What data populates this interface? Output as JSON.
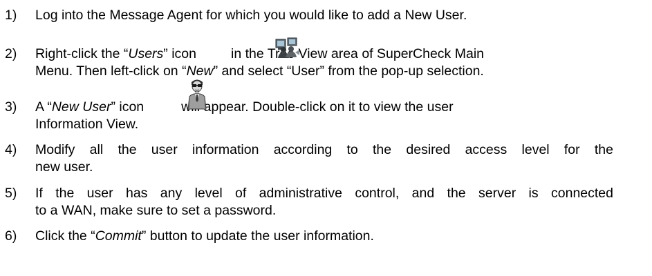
{
  "steps": [
    {
      "num": "1)",
      "text": "Log into the Message Agent for which you would like to add a New User."
    },
    {
      "num": "2)",
      "line1_a": "Right-click the “",
      "line1_em": "Users",
      "line1_b": "” icon",
      "line1_c": "in the Tree View area of SuperCheck Main",
      "line2_a": "Menu. Then left-click  on “",
      "line2_em": "New",
      "line2_b": "” and select “User” from the pop-up selection.",
      "icon": "users-tree-icon"
    },
    {
      "num": "3)",
      "line1_a": "A “",
      "line1_em": "New User",
      "line1_b": "”  icon",
      "line1_c": "will  appear.  Double-click  on  it  to  view  the  user",
      "line2": "Information View.",
      "icon": "new-user-icon"
    },
    {
      "num": "4)",
      "line1": "Modify all the user information according to the desired access level for the",
      "line2": "new user."
    },
    {
      "num": "5)",
      "line1": "If the user has any level of administrative control, and the server is connected",
      "line2": "to a WAN, make sure to set a password."
    },
    {
      "num": "6)",
      "text_a": "Click the “",
      "text_em": "Commit",
      "text_b": "” button to update the user information."
    }
  ]
}
